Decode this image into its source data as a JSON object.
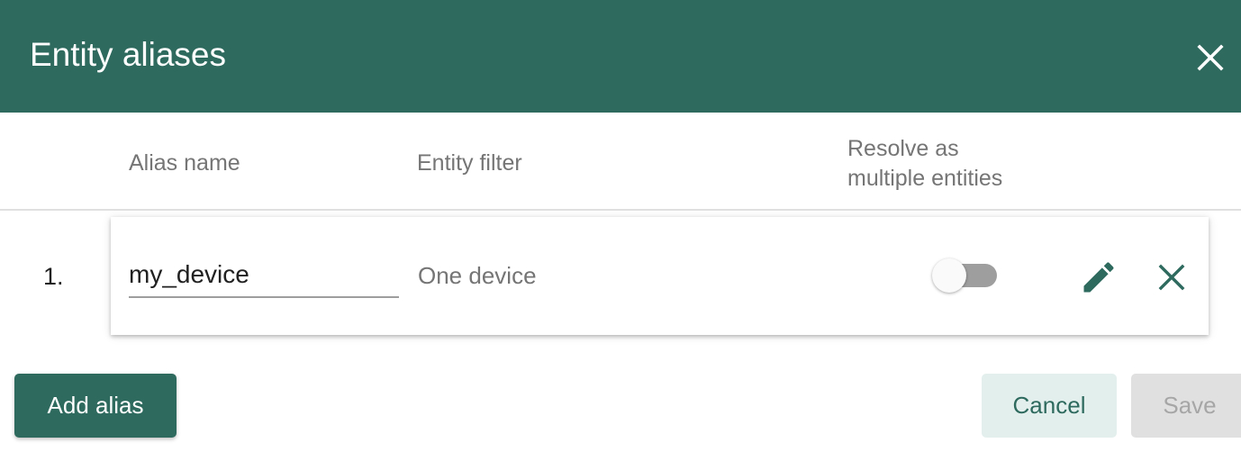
{
  "dialog": {
    "title": "Entity aliases"
  },
  "table": {
    "headers": {
      "alias_name": "Alias name",
      "entity_filter": "Entity filter",
      "resolve_line1": "Resolve as",
      "resolve_line2": "multiple entities"
    },
    "rows": [
      {
        "index": "1.",
        "alias_name": "my_device",
        "entity_filter": "One device",
        "resolve_multiple": false
      }
    ]
  },
  "actions": {
    "add_alias_label": "Add alias",
    "cancel_label": "Cancel",
    "save_label": "Save"
  },
  "colors": {
    "primary": "#2e6a5e",
    "cancel_bg": "#e3efed",
    "disabled_bg": "#e0e0e0",
    "disabled_text": "#a6a6a6",
    "toggle_off_track": "#9e9e9e"
  },
  "icons": {
    "close": "close-icon",
    "edit": "pencil-icon",
    "remove": "close-icon"
  }
}
